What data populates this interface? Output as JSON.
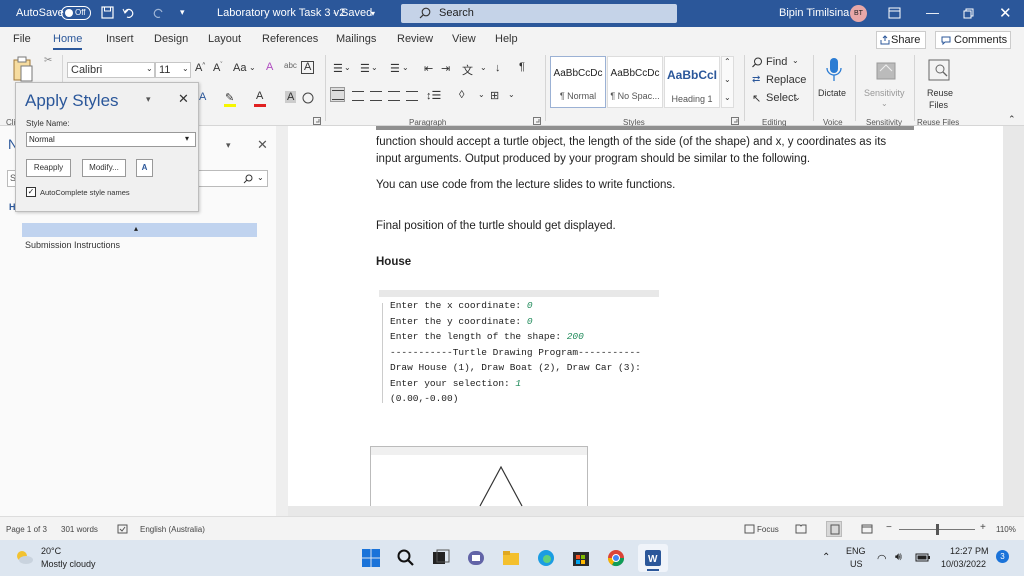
{
  "titlebar": {
    "autosave_label": "AutoSave",
    "autosave_state": "Off",
    "doc_title": "Laboratory work Task 3 v2",
    "save_status": "Saved",
    "search_placeholder": "Search",
    "user_name": "Bipin Timilsina",
    "user_initials": "BT",
    "title_color": "#2b579a"
  },
  "menu": {
    "items": [
      "File",
      "Home",
      "Insert",
      "Design",
      "Layout",
      "References",
      "Mailings",
      "Review",
      "View",
      "Help"
    ],
    "active": "Home",
    "share_label": "Share",
    "comments_label": "Comments"
  },
  "ribbon": {
    "font_name": "Calibri",
    "font_size": "11",
    "change_case": "Aa",
    "styles": [
      {
        "preview": "AaBbCcDc",
        "name": "¶ Normal"
      },
      {
        "preview": "AaBbCcDc",
        "name": "¶ No Spac..."
      },
      {
        "preview": "AaBbCcI",
        "name": "Heading 1"
      }
    ],
    "find_label": "Find",
    "replace_label": "Replace",
    "select_label": "Select",
    "dictate_label": "Dictate",
    "sensitivity_label": "Sensitivity",
    "reuse_label": "Reuse",
    "reuse_label2": "Files",
    "groups": {
      "clipboard": "Cli",
      "paragraph": "Paragraph",
      "styles": "Styles",
      "editing": "Editing",
      "voice": "Voice",
      "sensitivity": "Sensitivity",
      "reuse": "Reuse Files"
    }
  },
  "apply_styles": {
    "title": "Apply Styles",
    "style_name_label": "Style Name:",
    "style_name_value": "Normal",
    "reapply_label": "Reapply",
    "modify_label": "Modify...",
    "styles_pane_glyph": "A",
    "autocomplete_label": "AutoComplete style names"
  },
  "nav": {
    "heading_letter": "N",
    "search_letter": "S",
    "h_letter": "H",
    "item": "Submission Instructions"
  },
  "document": {
    "para1_line1": "function should accept a turtle object, the length of the side (of the shape) and x, y coordinates as its",
    "para1_line2": "input arguments. Output produced by your program should be similar to the following.",
    "para2": "You can use code from the lecture slides to write functions.",
    "para3": "Final position of the turtle should get displayed.",
    "heading_house": "House",
    "console_lines": [
      {
        "prompt": "Enter the x coordinate: ",
        "value": "0"
      },
      {
        "prompt": "Enter the y coordinate: ",
        "value": "0"
      },
      {
        "prompt": "Enter the length of the shape: ",
        "value": "200"
      },
      {
        "prompt": "-----------Turtle Drawing Program-----------",
        "value": ""
      },
      {
        "prompt": "Draw House (1), Draw Boat (2), Draw Car (3):",
        "value": ""
      },
      {
        "prompt": "Enter your selection: ",
        "value": "1"
      },
      {
        "prompt": "(0.00,-0.00)",
        "value": ""
      }
    ]
  },
  "status": {
    "page": "Page 1 of 3",
    "words": "301 words",
    "language": "English (Australia)",
    "focus": "Focus",
    "zoom": "110%"
  },
  "taskbar": {
    "weather_temp": "20°C",
    "weather_desc": "Mostly cloudy",
    "lang1": "ENG",
    "lang2": "US",
    "time": "12:27 PM",
    "date": "10/03/2022",
    "notif_count": "3"
  }
}
